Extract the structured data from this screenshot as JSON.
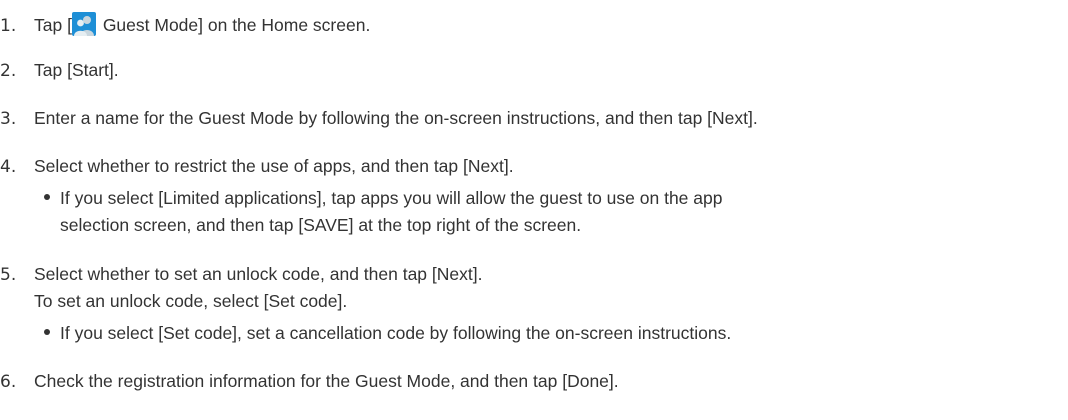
{
  "steps": [
    {
      "num": "1.",
      "before": "Tap [",
      "icon": "guest-mode-icon",
      "after": " Guest Mode] on the Home screen."
    },
    {
      "num": "2.",
      "text": "Tap [Start]."
    },
    {
      "num": "3.",
      "text": "Enter a name for the Guest Mode by following the on-screen instructions, and then tap [Next]."
    },
    {
      "num": "4.",
      "text": "Select whether to restrict the use of apps, and then tap [Next].",
      "bullet_line1": "If you select [Limited applications], tap apps you will allow the guest to use on the app",
      "bullet_line2": "selection screen, and then tap [SAVE] at the top right of the screen."
    },
    {
      "num": "5.",
      "text": "Select whether to set an unlock code, and then tap [Next].",
      "sub": "To set an unlock code, select [Set code].",
      "bullet": "If you select [Set code], set a cancellation code by following the on-screen instructions."
    },
    {
      "num": "6.",
      "text": "Check the registration information for the Guest Mode, and then tap [Done]."
    }
  ],
  "colors": {
    "text": "#333333",
    "icon_bg": "#1e8fd6"
  }
}
